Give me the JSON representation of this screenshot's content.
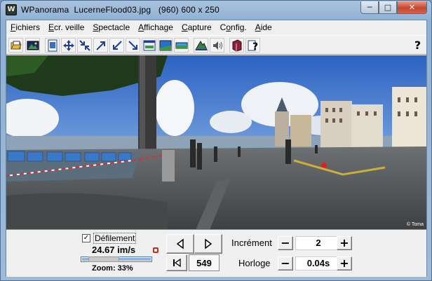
{
  "window": {
    "title": "WPanorama  LucerneFlood03.jpg   (960) 600 x 250",
    "app_icon_glyph": "W",
    "controls": {
      "minimize": "─",
      "maximize": "□",
      "close": "✕"
    }
  },
  "menu": [
    {
      "label": "Fichiers",
      "accel": "F",
      "rest": "ichiers"
    },
    {
      "label": "Ecr. veille",
      "accel": "E",
      "rest": "cr. veille"
    },
    {
      "label": "Spectacle",
      "accel": "S",
      "rest": "pectacle"
    },
    {
      "label": "Affichage",
      "accel": "A",
      "rest": "ffichage"
    },
    {
      "label": "Capture",
      "accel": "C",
      "rest": "apture"
    },
    {
      "label": "Config.",
      "accel": "o",
      "pre": "C",
      "rest": "nfig."
    },
    {
      "label": "Aide",
      "accel": "A",
      "rest": "ide"
    }
  ],
  "toolbar": {
    "icons": [
      "open-folder-icon",
      "picture-icon",
      "page-icon",
      "move-icon",
      "shrink-icon",
      "zoom-in-icon",
      "zoom-out-icon",
      "zoom-fit-icon",
      "scroll-window-icon",
      "scroll-mode-icon",
      "band-icon",
      "mountain-icon",
      "sound-icon",
      "book-icon",
      "help-doc-icon"
    ],
    "help_label": "?"
  },
  "viewport": {
    "credit": "© Toma"
  },
  "controls": {
    "scroll_checkbox_mark": "✓",
    "scroll_label": "Défilement",
    "speed": "24.67 im/s",
    "zoom": "Zoom: 33%",
    "zoom_level": 0.33,
    "frame_counter": "549",
    "increment_label": "Incrément",
    "increment_value": "2",
    "clock_label": "Horloge",
    "clock_value": "0.04s",
    "minus": "−",
    "plus": "+"
  },
  "colors": {
    "accent": "#1f5fbf",
    "close": "#c6462c"
  }
}
